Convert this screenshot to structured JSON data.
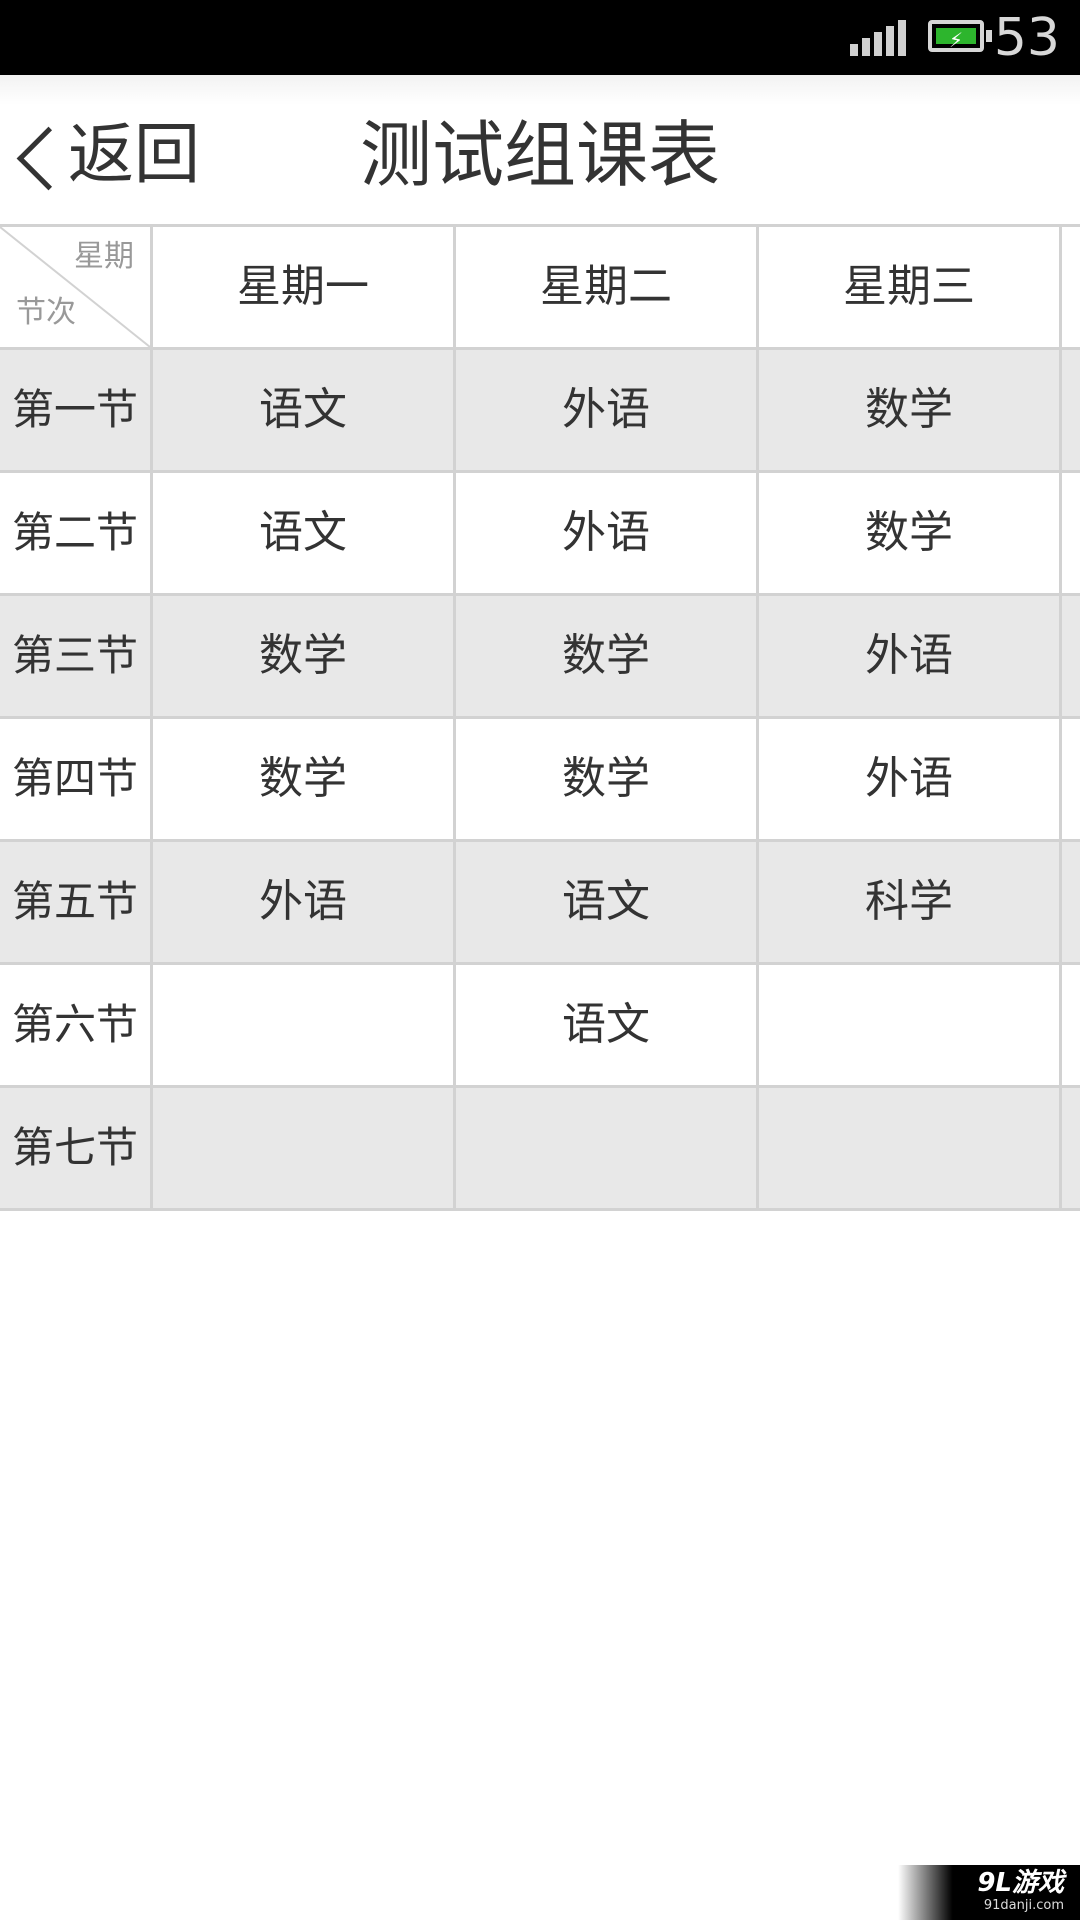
{
  "status_bar": {
    "battery_percent": "53",
    "battery_charging": true,
    "battery_color": "#2db52d",
    "signal_icon": "signal-bars-icon",
    "battery_icon": "battery-charging-icon"
  },
  "header": {
    "back_label": "返回",
    "back_icon": "chevron-left-icon",
    "title": "测试组课表"
  },
  "timetable": {
    "corner_week_label": "星期",
    "corner_period_label": "节次",
    "days": [
      "星期一",
      "星期二",
      "星期三"
    ],
    "rows": [
      {
        "period": "第一节",
        "cells": [
          "语文",
          "外语",
          "数学"
        ]
      },
      {
        "period": "第二节",
        "cells": [
          "语文",
          "外语",
          "数学"
        ]
      },
      {
        "period": "第三节",
        "cells": [
          "数学",
          "数学",
          "外语"
        ]
      },
      {
        "period": "第四节",
        "cells": [
          "数学",
          "数学",
          "外语"
        ]
      },
      {
        "period": "第五节",
        "cells": [
          "外语",
          "语文",
          "科学"
        ]
      },
      {
        "period": "第六节",
        "cells": [
          "",
          "语文",
          ""
        ]
      },
      {
        "period": "第七节",
        "cells": [
          "",
          "",
          ""
        ]
      }
    ],
    "shaded_row_color": "#e8e8e8",
    "grid_color": "#d2d2d2"
  },
  "watermark": {
    "logo_text": "9L游戏",
    "url_text": "91danji.com"
  }
}
